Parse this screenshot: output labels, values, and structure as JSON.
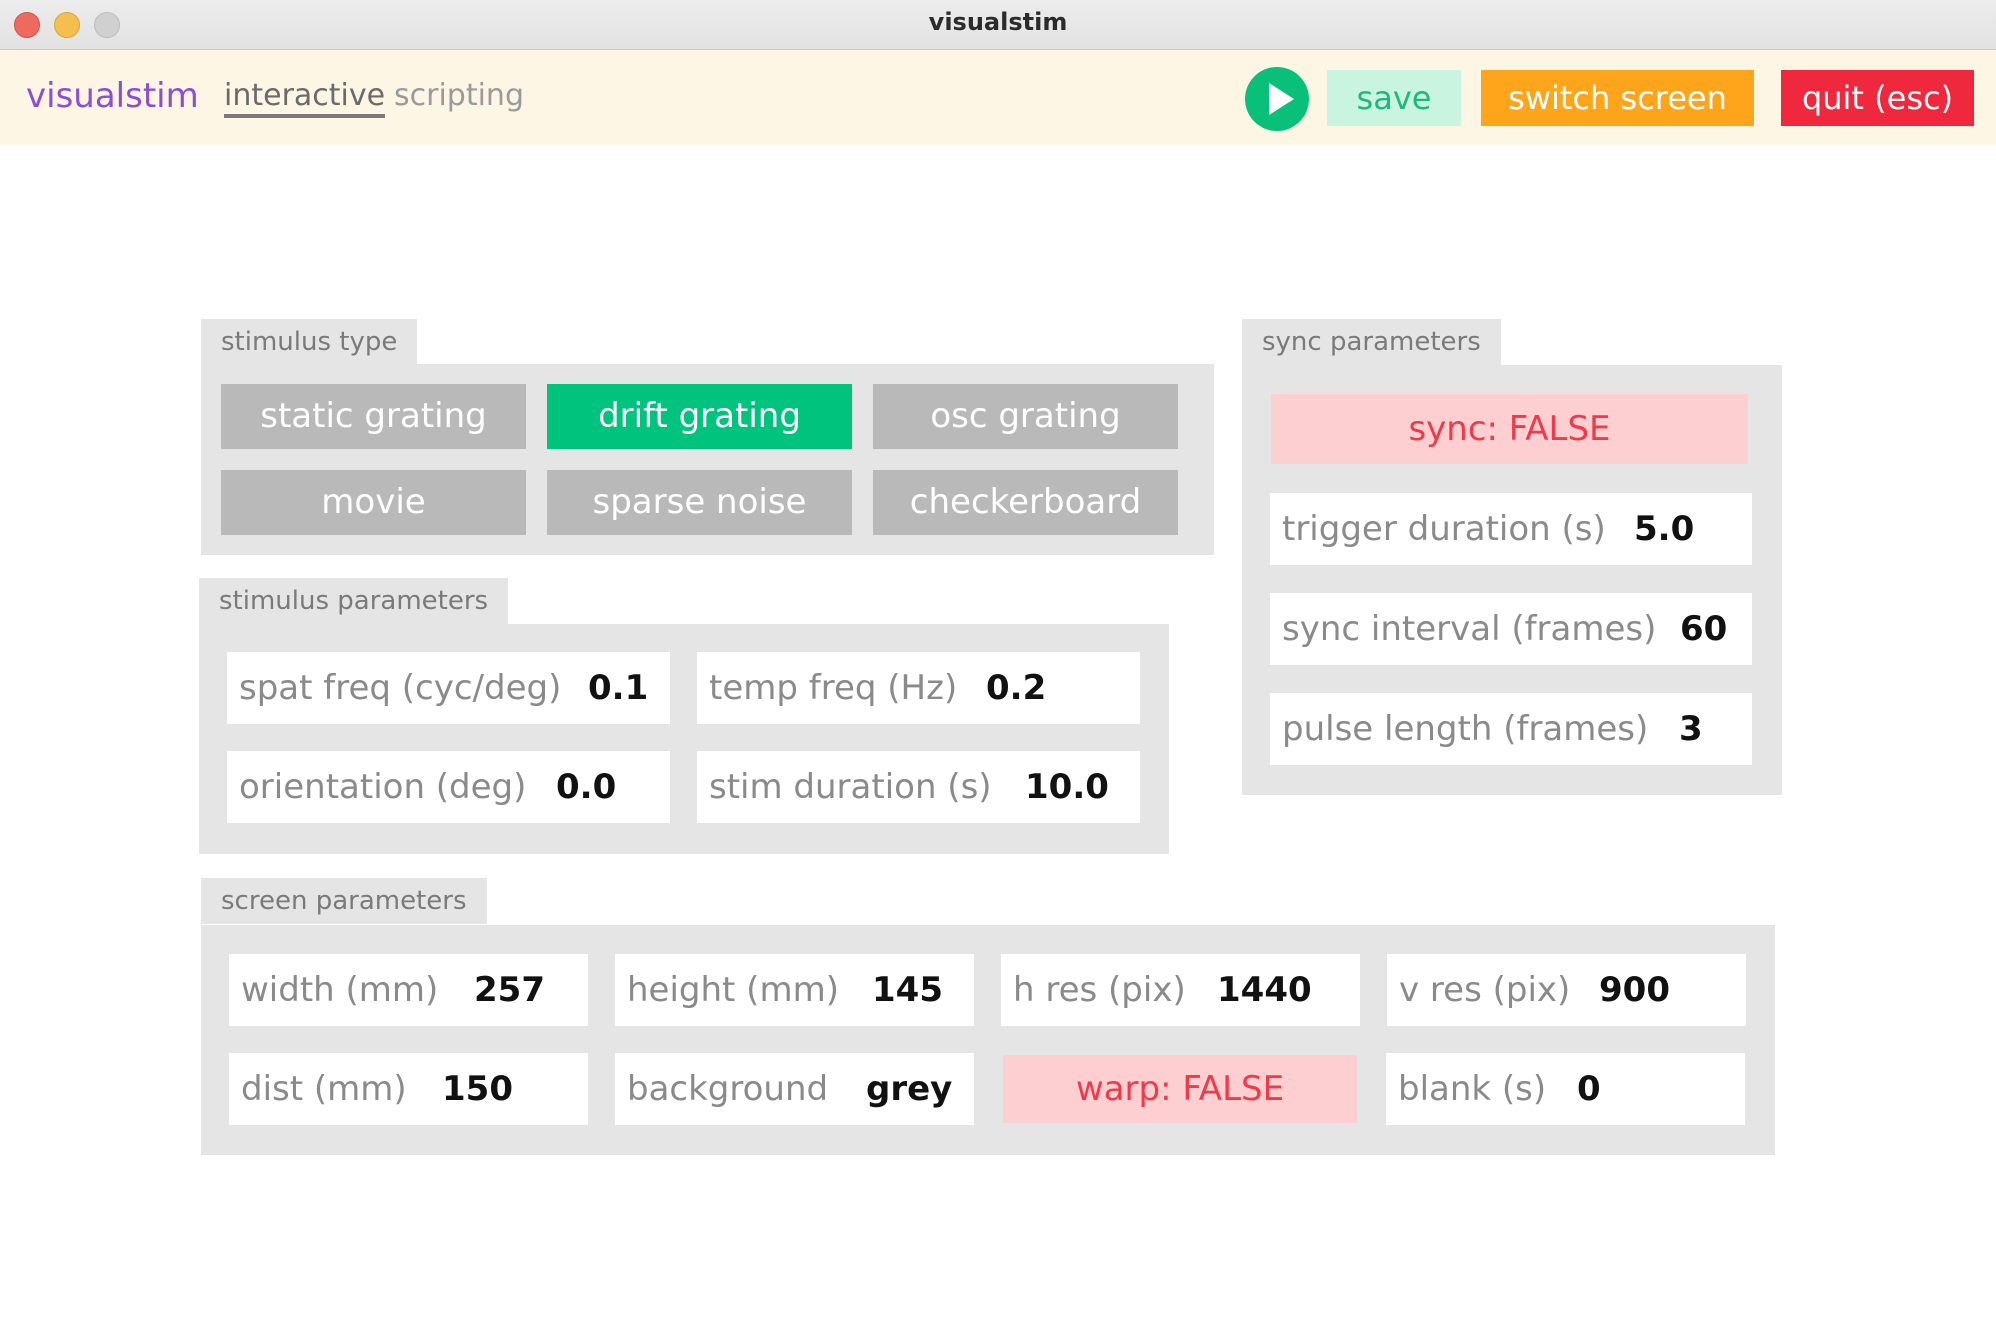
{
  "window": {
    "title": "visualstim"
  },
  "header": {
    "app_name": "visualstim",
    "tabs": [
      {
        "label": "interactive",
        "active": true
      },
      {
        "label": "scripting",
        "active": false
      }
    ],
    "buttons": {
      "save": "save",
      "switch_screen": "switch screen",
      "quit": "quit (esc)"
    }
  },
  "stimulus_type": {
    "title": "stimulus type",
    "options": [
      {
        "label": "static grating",
        "selected": false
      },
      {
        "label": "drift grating",
        "selected": true
      },
      {
        "label": "osc grating",
        "selected": false
      },
      {
        "label": "movie",
        "selected": false
      },
      {
        "label": "sparse noise",
        "selected": false
      },
      {
        "label": "checkerboard",
        "selected": false
      }
    ]
  },
  "stimulus_parameters": {
    "title": "stimulus parameters",
    "fields": [
      {
        "label": "spat freq (cyc/deg)",
        "value": "0.1"
      },
      {
        "label": "temp freq (Hz)",
        "value": "0.2"
      },
      {
        "label": "orientation (deg)",
        "value": "0.0"
      },
      {
        "label": "stim duration (s)",
        "value": "10.0"
      }
    ]
  },
  "sync_parameters": {
    "title": "sync parameters",
    "sync_flag": "sync: FALSE",
    "fields": [
      {
        "label": "trigger duration (s)",
        "value": "5.0"
      },
      {
        "label": "sync interval (frames)",
        "value": "60"
      },
      {
        "label": "pulse length (frames)",
        "value": "3"
      }
    ]
  },
  "screen_parameters": {
    "title": "screen parameters",
    "fields": [
      {
        "label": "width (mm)",
        "value": "257"
      },
      {
        "label": "height (mm)",
        "value": "145"
      },
      {
        "label": "h res (pix)",
        "value": "1440"
      },
      {
        "label": "v res (pix)",
        "value": "900"
      },
      {
        "label": "dist (mm)",
        "value": "150"
      },
      {
        "label": "background",
        "value": "grey"
      },
      {
        "label": "blank (s)",
        "value": "0"
      }
    ],
    "warp_flag": "warp: FALSE"
  },
  "colors": {
    "accent": "#8a4fd6",
    "active_green": "#00c47d",
    "switch_orange": "#ffa51c",
    "quit_red": "#f0283e",
    "flag_bg": "#fdcfd1",
    "flag_text": "#f03a4a",
    "panel_bg": "#e5e5e5",
    "header_bg": "#fdf6e4"
  },
  "icons": {
    "play": "play-icon"
  }
}
